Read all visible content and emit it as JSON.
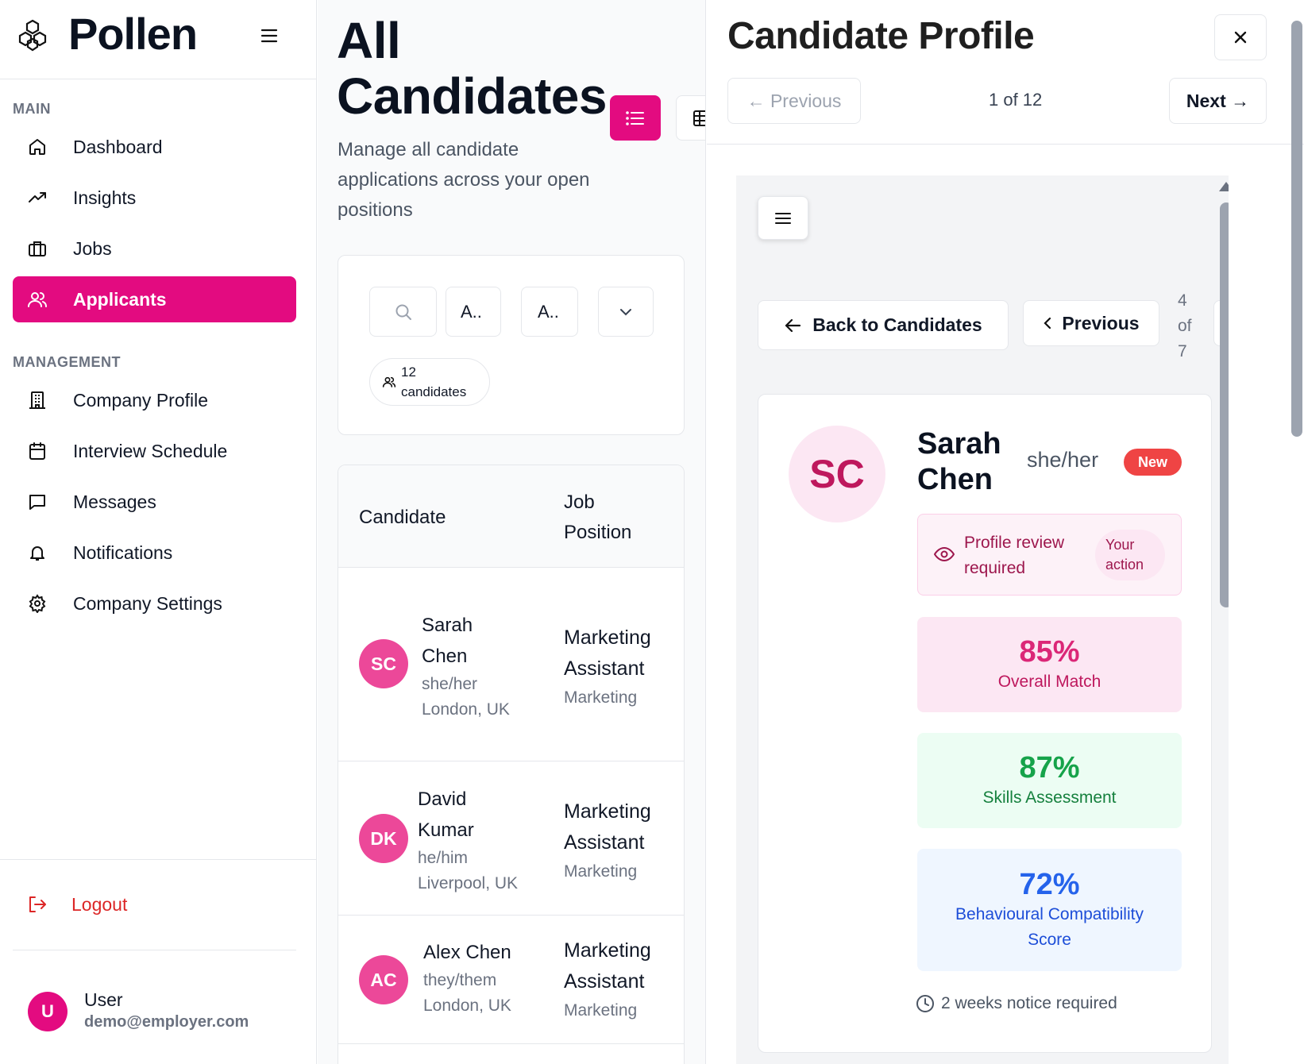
{
  "app": {
    "name": "Pollen",
    "menu_icon": "hamburger-icon",
    "logo_icon": "hexagon-cluster-icon"
  },
  "sidebar": {
    "main_label": "MAIN",
    "main_items": [
      {
        "label": "Dashboard",
        "icon": "home-icon"
      },
      {
        "label": "Insights",
        "icon": "trend-up-icon"
      },
      {
        "label": "Jobs",
        "icon": "briefcase-icon"
      },
      {
        "label": "Applicants",
        "icon": "users-icon",
        "active": true
      }
    ],
    "management_label": "MANAGEMENT",
    "management_items": [
      {
        "label": "Company Profile",
        "icon": "building-icon"
      },
      {
        "label": "Interview Schedule",
        "icon": "calendar-icon"
      },
      {
        "label": "Messages",
        "icon": "message-icon"
      },
      {
        "label": "Notifications",
        "icon": "bell-icon"
      },
      {
        "label": "Company Settings",
        "icon": "gear-icon"
      }
    ],
    "logout_label": "Logout",
    "user": {
      "initial": "U",
      "name": "User",
      "email": "demo@employer.com"
    }
  },
  "candidates_page": {
    "title_line1": "All",
    "title_line2": "Candidates",
    "subtitle_line1": "Manage all candidate",
    "subtitle_line2": "applications across your open",
    "subtitle_line3": "positions",
    "filters": {
      "filter1": "A..",
      "filter2": "A.."
    },
    "count_number": "12",
    "count_label": "candidates",
    "columns": {
      "candidate": "Candidate",
      "position_line1": "Job",
      "position_line2": "Position"
    },
    "rows": [
      {
        "initials": "SC",
        "first": "Sarah",
        "last": "Chen",
        "pronouns": "she/her",
        "location": "London, UK",
        "pos1": "Marketing",
        "pos2": "Assistant",
        "dept": "Marketing"
      },
      {
        "initials": "DK",
        "first": "David",
        "last": "Kumar",
        "pronouns": "he/him",
        "location": "Liverpool, UK",
        "pos1": "Marketing",
        "pos2": "Assistant",
        "dept": "Marketing"
      },
      {
        "initials": "AC",
        "name": "Alex Chen",
        "pronouns": "they/them",
        "location": "London, UK",
        "pos1": "Marketing",
        "pos2": "Assistant",
        "dept": "Marketing"
      }
    ]
  },
  "profile_panel": {
    "title": "Candidate Profile",
    "previous_label": "← Previous",
    "counter": "1 of 12",
    "next_label": "Next →",
    "back_label": "Back to Candidates",
    "inner_previous_label": "Previous",
    "inner_counter": {
      "n": "4",
      "of": "of",
      "total": "7"
    },
    "candidate": {
      "initials": "SC",
      "first": "Sarah",
      "last": "Chen",
      "pronouns": "she/her",
      "badge": "New",
      "review_line1": "Profile review",
      "review_line2": "required",
      "action_line1": "Your",
      "action_line2": "action",
      "notice": "2 weeks notice required"
    },
    "scores": [
      {
        "value": "85%",
        "label_line1": "Overall Match",
        "label_line2": "",
        "color": "#db2777",
        "bg": "#fce7f3"
      },
      {
        "value": "87%",
        "label_line1": "Skills Assessment",
        "label_line2": "",
        "color": "#16a34a",
        "bg": "#ecfdf3"
      },
      {
        "value": "72%",
        "label_line1": "Behavioural Compatibility",
        "label_line2": "Score",
        "color": "#2563eb",
        "bg": "#eff6ff"
      }
    ]
  },
  "colors": {
    "accent": "#e30b80",
    "logout": "#dc2626"
  }
}
